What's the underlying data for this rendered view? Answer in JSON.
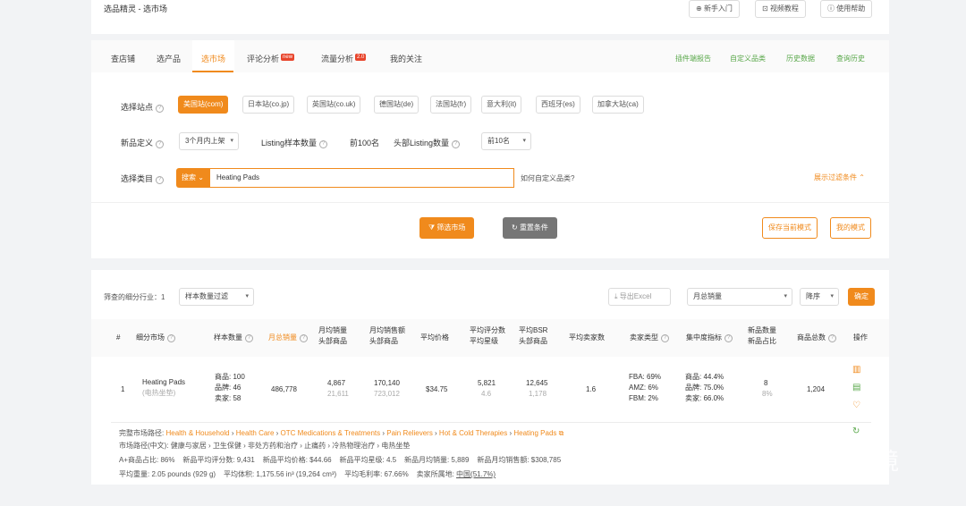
{
  "breadcrumb": "选品精灵 - 选市场",
  "top_buttons": [
    "新手入门",
    "视频教程",
    "使用帮助"
  ],
  "tabs": [
    {
      "label": "查店铺",
      "badge": ""
    },
    {
      "label": "选产品",
      "badge": ""
    },
    {
      "label": "选市场",
      "badge": ""
    },
    {
      "label": "评论分析",
      "badge": "new"
    },
    {
      "label": "流量分析",
      "badge": "2.0"
    },
    {
      "label": "我的关注",
      "badge": ""
    }
  ],
  "right_links": [
    "插件端报告",
    "自定义品类",
    "历史数据",
    "查询历史"
  ],
  "filters": {
    "site_label": "选择站点",
    "sites": [
      "美国站(com)",
      "日本站(co.jp)",
      "英国站(co.uk)",
      "德国站(de)",
      "法国站(fr)",
      "意大利(it)",
      "西班牙(es)",
      "加拿大站(ca)"
    ],
    "new_def_label": "新品定义",
    "new_def_value": "3个月内上架",
    "sample_label": "Listing样本数量",
    "sample_value": "前100名",
    "head_label": "头部Listing数量",
    "head_value": "前10名",
    "category_label": "选择类目",
    "search_prefix": "搜索",
    "search_value": "Heating Pads",
    "custom_link": "如何自定义品类?",
    "show_filter": "展示过滤条件",
    "btn_filter": "筛选市场",
    "btn_reset": "重置条件",
    "btn_save": "保存当前模式",
    "btn_mymode": "我的模式"
  },
  "results": {
    "count_label": "筛查的细分行业：1",
    "sample_filter": "样本数量过滤",
    "export": "导出Excel",
    "sort_field": "月总销量",
    "sort_order": "降序",
    "confirm": "确定",
    "headers": [
      "#",
      "细分市场",
      "样本数量",
      "月总销量",
      "月均销量\n头部商品",
      "月均销售额\n头部商品",
      "平均价格",
      "平均评分数\n平均星级",
      "平均BSR\n头部商品",
      "平均卖家数",
      "卖家类型",
      "集中度指标",
      "新品数量\n新品占比",
      "商品总数",
      "操作"
    ],
    "row": {
      "index": "1",
      "market": "Heating Pads",
      "market_cn": "(电热坐垫)",
      "sample_lines": [
        "商品: 100",
        "品牌: 46",
        "卖家: 58"
      ],
      "monthly_total": "486,778",
      "avg_sales": "4,867",
      "avg_sales_head": "21,611",
      "avg_revenue": "170,140",
      "avg_revenue_head": "723,012",
      "avg_price": "$34.75",
      "avg_reviews": "5,821",
      "avg_stars": "4.6",
      "avg_bsr": "12,645",
      "avg_bsr_head": "1,178",
      "avg_sellers": "1.6",
      "seller_types": [
        "FBA: 69%",
        "AMZ: 6%",
        "FBM: 2%"
      ],
      "concentration": [
        "商品: 44.4%",
        "品牌: 75.0%",
        "卖家: 66.0%"
      ],
      "new_count": "8",
      "new_ratio": "8%",
      "total_items": "1,204"
    },
    "path_label": "完整市场路径:",
    "path": [
      "Health & Household",
      "Health Care",
      "OTC Medications & Treatments",
      "Pain Relievers",
      "Hot & Cold Therapies",
      "Heating Pads"
    ],
    "path_cn": "市场路径(中文): 健康与家居 › 卫生保健 › 非处方药和治疗 › 止痛药 › 冷热物理治疗 › 电热坐垫",
    "stats_line1": "A+商品占比: 86%    新品平均评分数: 9,431    新品平均价格: $44.66    新品平均星级: 4.5    新品月均销量: 5,889    新品月均销售额: $308,785",
    "stats_line2_pre": "平均重量: 2.05 pounds (929 g)    平均体积: 1,175.56 in³ (19,264 cm³)    平均毛利率: 67.66%    卖家所属地: ",
    "stats_line2_link": "中国(51.7%)"
  },
  "watermark": "知乎 @tegan跨境"
}
